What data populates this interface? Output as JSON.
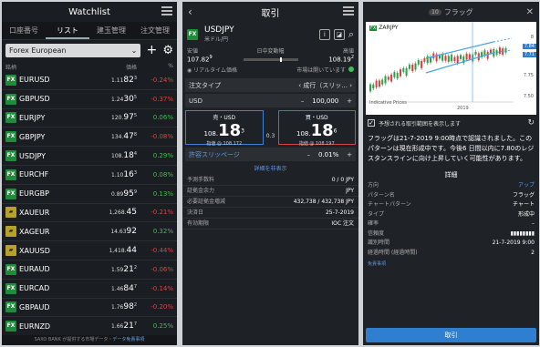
{
  "watchlist": {
    "title": "Watchlist",
    "tabs": [
      "口座番号",
      "リスト",
      "建玉管理",
      "注文管理"
    ],
    "list_select": "Forex European",
    "columns": {
      "symbol": "銘柄",
      "price": "価格",
      "pct": "%"
    },
    "rows": [
      {
        "icon": "FX",
        "symbol": "EURUSD",
        "p1": "1.11",
        "p2": "82",
        "p3": "3",
        "pct": "-0.24%",
        "neg": true
      },
      {
        "icon": "FX",
        "symbol": "GBPUSD",
        "p1": "1.24",
        "p2": "30",
        "p3": "5",
        "pct": "-0.37%",
        "neg": true
      },
      {
        "icon": "FX",
        "symbol": "EURJPY",
        "p1": "120.",
        "p2": "97",
        "p3": "5",
        "pct": "0.06%",
        "neg": false
      },
      {
        "icon": "FX",
        "symbol": "GBPJPY",
        "p1": "134.",
        "p2": "47",
        "p3": "8",
        "pct": "-0.08%",
        "neg": true
      },
      {
        "icon": "FX",
        "symbol": "USDJPY",
        "p1": "108.",
        "p2": "18",
        "p3": "4",
        "pct": "0.29%",
        "neg": false
      },
      {
        "icon": "FX",
        "symbol": "EURCHF",
        "p1": "1.10",
        "p2": "16",
        "p3": "3",
        "pct": "0.08%",
        "neg": false
      },
      {
        "icon": "FX",
        "symbol": "EURGBP",
        "p1": "0.89",
        "p2": "95",
        "p3": "9",
        "pct": "0.13%",
        "neg": false
      },
      {
        "icon": "gold",
        "symbol": "XAUEUR",
        "p1": "1,268.",
        "p2": "45",
        "p3": "",
        "pct": "-0.21%",
        "neg": true
      },
      {
        "icon": "gold",
        "symbol": "XAGEUR",
        "p1": "14.63",
        "p2": "92",
        "p3": "",
        "pct": "0.32%",
        "neg": false
      },
      {
        "icon": "gold",
        "symbol": "XAUUSD",
        "p1": "1,418.",
        "p2": "44",
        "p3": "",
        "pct": "-0.44%",
        "neg": true
      },
      {
        "icon": "FX",
        "symbol": "EURAUD",
        "p1": "1.59",
        "p2": "21",
        "p3": "2",
        "pct": "-0.06%",
        "neg": true
      },
      {
        "icon": "FX",
        "symbol": "EURCAD",
        "p1": "1.46",
        "p2": "84",
        "p3": "7",
        "pct": "-0.14%",
        "neg": true
      },
      {
        "icon": "FX",
        "symbol": "GBPAUD",
        "p1": "1.76",
        "p2": "98",
        "p3": "2",
        "pct": "-0.20%",
        "neg": true
      },
      {
        "icon": "FX",
        "symbol": "EURNZD",
        "p1": "1.66",
        "p2": "21",
        "p3": "7",
        "pct": "0.25%",
        "neg": false
      }
    ],
    "footer_a": "SAXO BANK が提供する市場データ・",
    "footer_b": "データ免責事項"
  },
  "trade": {
    "title": "取引",
    "instrument": "USDJPY",
    "instrument_sub": "米ドル/円",
    "labels": {
      "bid": "安値",
      "change": "日中変動幅",
      "ask": "高値"
    },
    "low": "107.82",
    "low_sup": "9",
    "high": "108.19",
    "high_sup": "2",
    "realtime": "リアルタイム価格",
    "market": "市場は開いています",
    "order_type_label": "注文タイプ",
    "order_type": "成行（スリッ...",
    "amount_label": "USD",
    "amount": "100,000",
    "sell": {
      "title": "売・USD",
      "pre": "108.",
      "big": "18",
      "post": "3",
      "limit": "指値 @ 108.172"
    },
    "buy": {
      "title": "買・USD",
      "pre": "108.",
      "big": "18",
      "post": "6",
      "limit": "指値 @ 108.197"
    },
    "spread": "0.3",
    "slippage_label": "許容スリッページ",
    "slippage": "0.01%",
    "hide_details": "詳細を非表示",
    "details": [
      {
        "k": "予測手数料",
        "v": "0 / 0 JPY"
      },
      {
        "k": "証拠金余力",
        "v": "JPY"
      },
      {
        "k": "必要証拠金増減",
        "v": "432,738 / 432,738 JPY"
      },
      {
        "k": "決済日",
        "v": "25-7-2019"
      },
      {
        "k": "有効期限",
        "v": "IOC 注文"
      }
    ]
  },
  "flag": {
    "title": "フラッグ",
    "badge": "10",
    "chart_symbol": "ZARJPY",
    "chart_caption": "Indicative Prices",
    "axis": {
      "top": "8",
      "mid1": "7.75",
      "mid2": "7.50",
      "x1": "2019"
    },
    "tag1": "7.84",
    "tag2": "7.71",
    "show_range": "予想される取引範囲を表示します",
    "description": "フラッグは21-7-2019 9:00時点で認識されました。このパターンは現在形成中です。今後6 日間以内に7.80のレジスタンスラインに向け上昇していく可能性があります。",
    "details_title": "詳細",
    "rows": [
      {
        "k": "方向",
        "v": "アップ"
      },
      {
        "k": "パターン名",
        "v": "フラッグ"
      },
      {
        "k": "チャートパターン",
        "v": "チャート"
      },
      {
        "k": "タイプ",
        "v": "形成中"
      },
      {
        "k": "確率",
        "v": "–"
      },
      {
        "k": "信頼度",
        "v": "▮▮▮▮▮▮▮▮"
      },
      {
        "k": "識別時間",
        "v": "21-7-2019 9:00"
      },
      {
        "k": "経過時間 (経過時間)",
        "v": "2"
      }
    ],
    "disclaimer": "免責事項",
    "trade_button": "取引"
  }
}
